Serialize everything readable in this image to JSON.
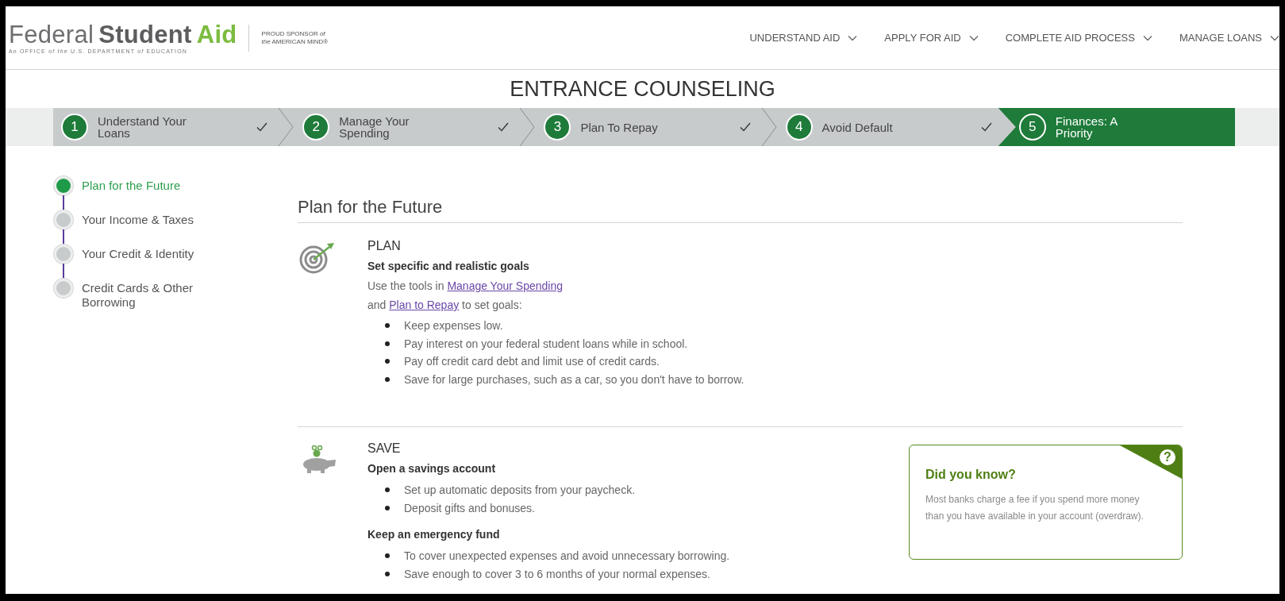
{
  "logo": {
    "name_light": "Federal",
    "name_bold": "Student",
    "name_accent": "Aid",
    "tagline": "An OFFICE *of the* U.S. DEPARTMENT *of* EDUCATION"
  },
  "sponsor": [
    "PROUD SPONSOR *of*",
    "*the* AMERICAN MIND®"
  ],
  "nav": [
    {
      "label": "UNDERSTAND AID"
    },
    {
      "label": "APPLY FOR AID"
    },
    {
      "label": "COMPLETE AID PROCESS"
    },
    {
      "label": "MANAGE LOANS"
    }
  ],
  "page_title": "ENTRANCE COUNSELING",
  "steps": [
    {
      "number": "1",
      "label": "Understand Your Loans",
      "completed": true,
      "selected": false
    },
    {
      "number": "2",
      "label": "Manage Your Spending",
      "completed": true,
      "selected": false
    },
    {
      "number": "3",
      "label": "Plan To Repay",
      "completed": true,
      "selected": false
    },
    {
      "number": "4",
      "label": "Avoid Default",
      "completed": true,
      "selected": false
    },
    {
      "number": "5",
      "label": "Finances: A Priority",
      "completed": false,
      "selected": true
    }
  ],
  "sidebar": {
    "items": [
      {
        "label": "Plan for the Future",
        "selected": true
      },
      {
        "label": "Your Income & Taxes",
        "selected": false
      },
      {
        "label": "Your Credit & Identity",
        "selected": false
      },
      {
        "label": "Credit Cards & Other Borrowing",
        "selected": false
      }
    ]
  },
  "content": {
    "heading": "Plan for the Future",
    "sections": [
      {
        "kind": "plan",
        "title": "PLAN",
        "blocks": [
          {
            "subheading": "Set specific and realistic goals",
            "intro": [
              {
                "before": "Use the tools in ",
                "link": "Manage Your Spending"
              },
              {
                "before": "and ",
                "link": "Plan to Repay",
                "after": " to set goals:"
              }
            ],
            "bullets": [
              "Keep expenses low.",
              "Pay interest on your federal student loans while in school.",
              "Pay off credit card debt and limit use of credit cards.",
              "Save for large purchases, such as a car, so you don't have to borrow."
            ]
          }
        ]
      },
      {
        "kind": "save",
        "title": "SAVE",
        "blocks": [
          {
            "subheading": "Open a savings account",
            "bullets": [
              "Set up automatic deposits from your paycheck.",
              "Deposit gifts and bonuses."
            ]
          },
          {
            "subheading": "Keep an emergency fund",
            "bullets": [
              "To cover unexpected expenses and avoid unnecessary borrowing.",
              "Save enough to cover 3 to 6 months of your normal expenses."
            ]
          }
        ],
        "callout": {
          "badge": "?",
          "title": "Did you know?",
          "text": "Most banks charge a fee if you spend more money than you have available in your account (overdraw)."
        }
      }
    ]
  }
}
